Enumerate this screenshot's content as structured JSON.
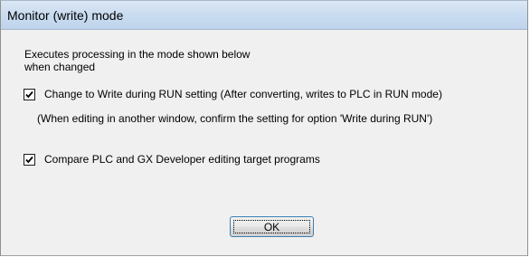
{
  "dialog": {
    "title": "Monitor (write) mode",
    "description_line1": "Executes processing in the mode shown below",
    "description_line2": "when changed",
    "options": [
      {
        "label": "Change to Write during RUN setting (After converting, writes to PLC in RUN mode)",
        "checked": true
      },
      {
        "label": "Compare PLC and GX Developer editing target programs",
        "checked": true
      }
    ],
    "note": "(When editing in another window, confirm the setting for option 'Write during RUN')",
    "ok_label": "OK"
  }
}
